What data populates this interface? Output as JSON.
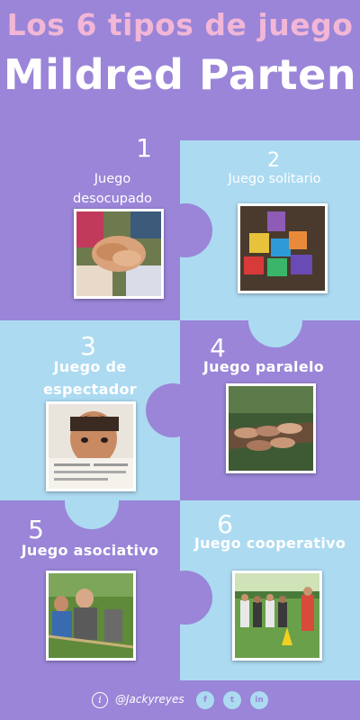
{
  "title": {
    "line1": "Los 6 tipos de juego",
    "line2": "Mildred Parten"
  },
  "colors": {
    "background": "#9a85d8",
    "light_blue": "#acdaf1",
    "title_pink": "#f2b6d6",
    "white": "#ffffff"
  },
  "types": [
    {
      "number": "1",
      "label_line1": "Juego",
      "label_line2": "desocupado",
      "photo": "hands-stacked-photo"
    },
    {
      "number": "2",
      "label_line1": "Juego solitario",
      "label_line2": "",
      "photo": "letter-blocks-photo"
    },
    {
      "number": "3",
      "label_line1": "Juego de",
      "label_line2": "espectador",
      "photo": "child-watching-photo"
    },
    {
      "number": "4",
      "label_line1": "Juego paralelo",
      "label_line2": "",
      "photo": "hands-on-log-photo"
    },
    {
      "number": "5",
      "label_line1": "Juego asociativo",
      "label_line2": "",
      "photo": "tug-of-war-photo"
    },
    {
      "number": "6",
      "label_line1": "Juego cooperativo",
      "label_line2": "",
      "photo": "group-game-photo"
    }
  ],
  "footer": {
    "handle": "@Jackyreyes",
    "icons": [
      "info-icon",
      "facebook-icon",
      "twitter-icon",
      "linkedin-icon"
    ],
    "facebook": "f",
    "twitter": "t",
    "linkedin": "in",
    "info": "i"
  }
}
